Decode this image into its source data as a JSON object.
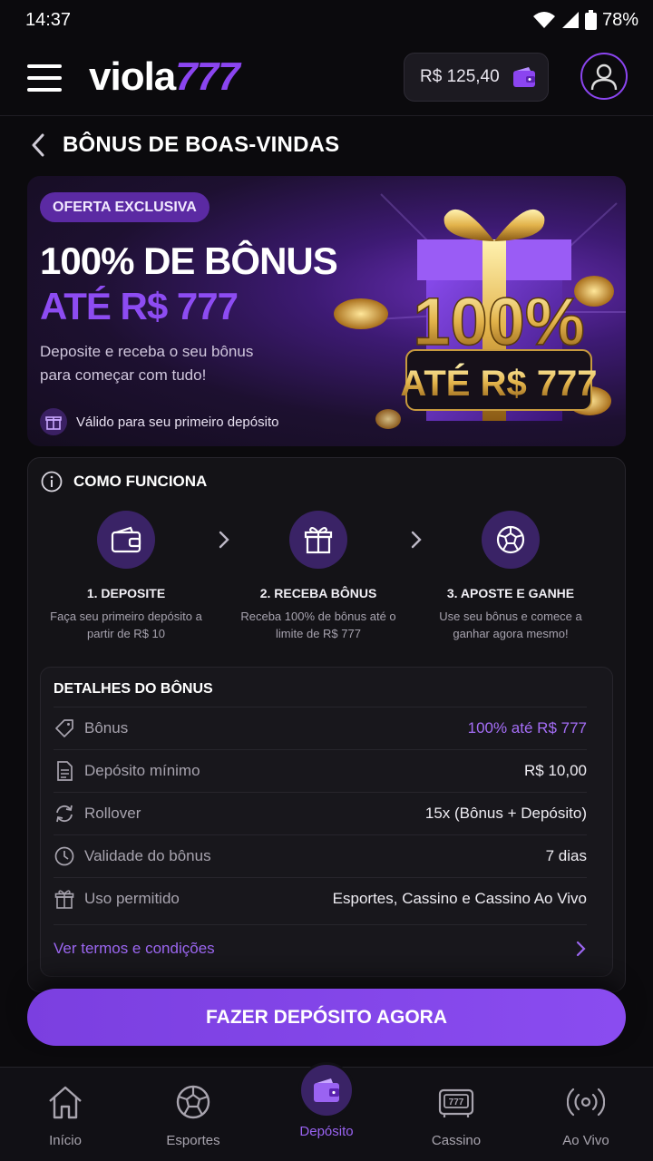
{
  "status_bar": {
    "time": "14:37",
    "battery": "78%"
  },
  "header": {
    "logo_text": "viola",
    "logo_number": "777",
    "balance": "R$ 125,40",
    "icons": {
      "menu": "hamburger-menu-icon",
      "wallet": "wallet-icon",
      "profile": "user-icon"
    }
  },
  "page": {
    "title": "BÔNUS DE BOAS-VINDAS"
  },
  "banner": {
    "badge": "OFERTA EXCLUSIVA",
    "headline": "100% DE BÔNUS",
    "subheadline": "ATÉ R$ 777",
    "description": "Deposite e receba o seu bônus para começar com tudo!",
    "validity": "Válido para seu primeiro depósito",
    "art_percent": "100%",
    "art_amount": "ATÉ R$ 777"
  },
  "how_it_works": {
    "title": "COMO FUNCIONA",
    "steps": [
      {
        "title": "1. DEPOSITE",
        "desc": "Faça seu primeiro depósito a partir de R$ 10",
        "icon": "wallet-icon"
      },
      {
        "title": "2. RECEBA BÔNUS",
        "desc": "Receba 100% de bônus até o limite de R$ 777",
        "icon": "gift-icon"
      },
      {
        "title": "3. APOSTE E GANHE",
        "desc": "Use seu bônus e comece a ganhar agora mesmo!",
        "icon": "soccer-ball-icon"
      }
    ]
  },
  "details": {
    "title": "DETALHES DO BÔNUS",
    "rows": [
      {
        "label": "Bônus",
        "value": "100% até R$ 777",
        "icon": "tag-icon"
      },
      {
        "label": "Depósito mínimo",
        "value": "R$ 10,00",
        "icon": "document-icon"
      },
      {
        "label": "Rollover",
        "value": "15x (Bônus + Depósito)",
        "icon": "refresh-icon"
      },
      {
        "label": "Validade do bônus",
        "value": "7 dias",
        "icon": "clock-icon"
      },
      {
        "label": "Uso permitido",
        "value": "Esportes, Cassino e Cassino Ao Vivo",
        "icon": "gift-icon"
      }
    ],
    "terms_link": "Ver termos e condições"
  },
  "cta": {
    "label": "FAZER DEPÓSITO AGORA"
  },
  "bottom_nav": [
    {
      "label": "Início",
      "icon": "home-icon",
      "active": false
    },
    {
      "label": "Esportes",
      "icon": "soccer-ball-icon",
      "active": false
    },
    {
      "label": "Depósito",
      "icon": "wallet-icon",
      "active": true
    },
    {
      "label": "Cassino",
      "icon": "slot-machine-icon",
      "active": false
    },
    {
      "label": "Ao Vivo",
      "icon": "live-broadcast-icon",
      "active": false
    }
  ],
  "colors": {
    "accent": "#8b45f0",
    "background": "#0b0a0d",
    "card": "#141317"
  }
}
